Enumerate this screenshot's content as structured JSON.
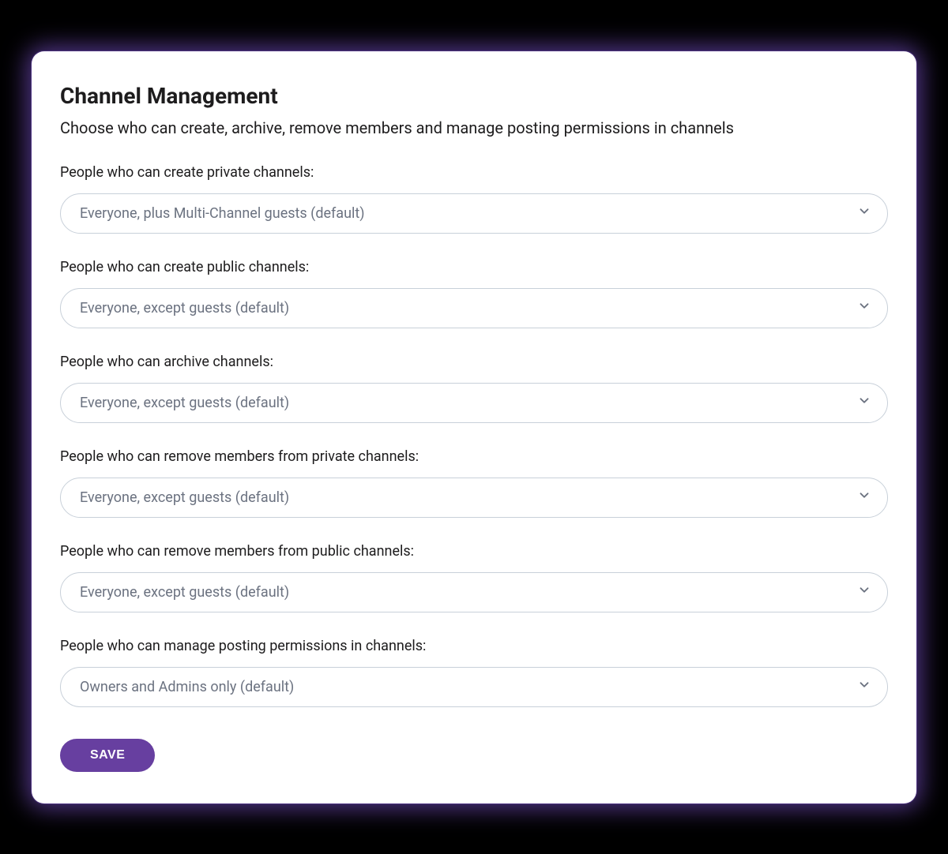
{
  "header": {
    "title": "Channel Management",
    "subtitle": "Choose who can create, archive, remove members and manage posting permissions in channels"
  },
  "fields": [
    {
      "label": "People who can create private channels:",
      "value": "Everyone, plus Multi-Channel guests (default)"
    },
    {
      "label": "People who can create public channels:",
      "value": "Everyone, except guests (default)"
    },
    {
      "label": "People who can archive channels:",
      "value": "Everyone, except guests (default)"
    },
    {
      "label": "People who can remove members from private channels:",
      "value": "Everyone, except guests (default)"
    },
    {
      "label": "People who can remove members from public channels:",
      "value": "Everyone, except guests (default)"
    },
    {
      "label": "People who can manage posting permissions in channels:",
      "value": "Owners and Admins only (default)"
    }
  ],
  "actions": {
    "save_label": "SAVE"
  }
}
